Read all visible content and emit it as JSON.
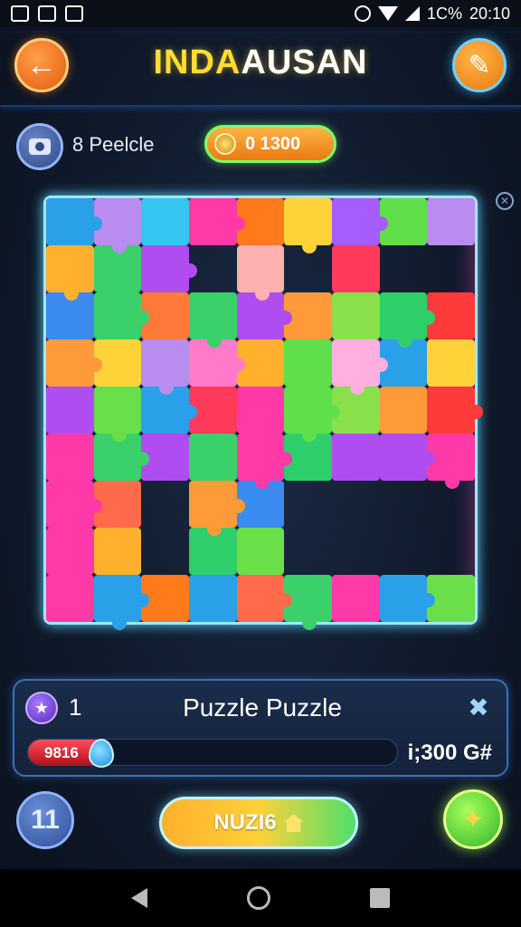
{
  "status_bar": {
    "battery": "1C%",
    "time": "20:10"
  },
  "header": {
    "title_part1": "INDA",
    "title_part2": "AUSAN",
    "back_icon": "arrow-left-icon",
    "edit_icon": "pencil-icon"
  },
  "info": {
    "pieces_label": "8 Peelcle",
    "coins_value": "0 1300"
  },
  "board": {
    "rows": 9,
    "cols": 9,
    "cells": [
      [
        "#2aa0e8",
        "#b98cf0",
        "#34c6f0",
        "#ff3aa8",
        "#ff7a1a",
        "#ffd23a",
        "#a65cff",
        "#5fe04a",
        "#b98cf0"
      ],
      [
        "#ffb12e",
        "#3ad16a",
        "#b04df0",
        "",
        "#ffb0b0",
        "",
        "#ff3a5a",
        "",
        ""
      ],
      [
        "#3a8bf0",
        "#3ad16a",
        "#ff7a3a",
        "#3ad16a",
        "#b04df0",
        "#ff9a3a",
        "#8ae04a",
        "#2ecf6a",
        "#ff3a3a"
      ],
      [
        "#ff9a3a",
        "#ffd23a",
        "#b98cf0",
        "#ff7ac8",
        "#ffb12e",
        "#5fe04a",
        "#ffb0e0",
        "#2aa0e8",
        "#ffd23a"
      ],
      [
        "#b04df0",
        "#6adf4a",
        "#2aa0e8",
        "#ff3a5a",
        "#ff3aa8",
        "#5fe04a",
        "#8ae04a",
        "#ff9a3a",
        "#ff3a3a"
      ],
      [
        "#ff3aa8",
        "#3ad16a",
        "#b04df0",
        "#3ad16a",
        "#ff3aa8",
        "#2ecf6a",
        "#b04df0",
        "#b04df0",
        "#ff3aa8"
      ],
      [
        "#ff3aa8",
        "#ff6a4a",
        "",
        "#ff9a3a",
        "#3a8bf0",
        "",
        "",
        "",
        ""
      ],
      [
        "#ff3aa8",
        "#ffb12e",
        "",
        "#2ecf6a",
        "#6adf4a",
        "",
        "",
        "",
        ""
      ],
      [
        "#ff3aa8",
        "#2aa0e8",
        "#ff7a1a",
        "#2aa0e8",
        "#ff6a4a",
        "#3ad16a",
        "#ff3aa8",
        "#2aa0e8",
        "#6adf4a"
      ]
    ]
  },
  "panel": {
    "level": "1",
    "puzzle_name": "Puzzle Puzzle",
    "progress_label": "9816",
    "progress": 0.2,
    "score": "i;300 G#",
    "shuffle_icon": "shuffle-icon"
  },
  "actions": {
    "hint_label": "11",
    "main_label": "NUZI6",
    "magic_icon": "magic-wand-icon"
  }
}
